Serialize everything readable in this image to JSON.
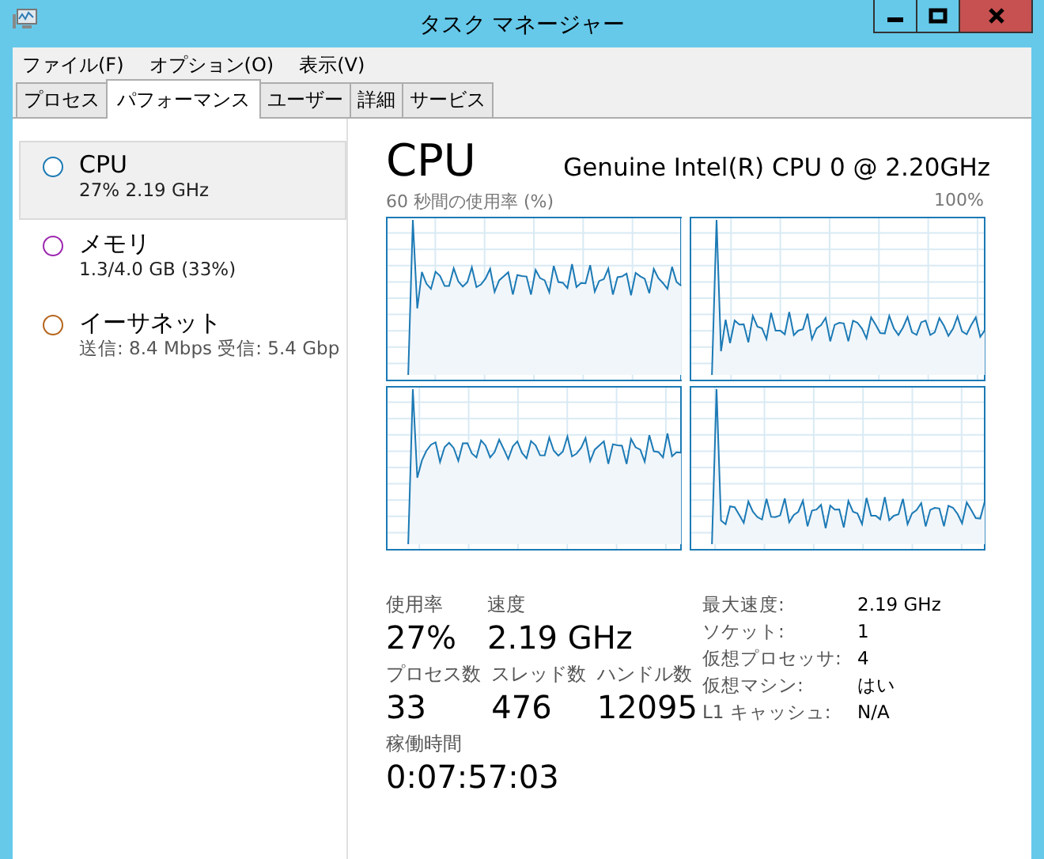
{
  "window": {
    "title": "タスク マネージャー"
  },
  "menu": [
    "ファイル(F)",
    "オプション(O)",
    "表示(V)"
  ],
  "tabs": [
    {
      "label": "プロセス",
      "selected": false
    },
    {
      "label": "パフォーマンス",
      "selected": true
    },
    {
      "label": "ユーザー",
      "selected": false
    },
    {
      "label": "詳細",
      "selected": false
    },
    {
      "label": "サービス",
      "selected": false
    }
  ],
  "sidebar": {
    "items": [
      {
        "name": "CPU",
        "detail": "27% 2.19 GHz",
        "color": "#1c7ab5",
        "selected": true
      },
      {
        "name": "メモリ",
        "detail": "1.3/4.0 GB (33%)",
        "color": "#9c27b0",
        "selected": false
      },
      {
        "name": "イーサネット",
        "detail": "送信: 8.4 Mbps 受信: 5.4 Gbp",
        "color": "#b5651d",
        "selected": false
      }
    ]
  },
  "panel": {
    "title": "CPU",
    "model": "Genuine Intel(R) CPU 0 @ 2.20GHz",
    "graph_label": "60 秒間の使用率 (%)",
    "graph_max": "100%",
    "stats": [
      {
        "label": "使用率",
        "value": "27%"
      },
      {
        "label": "速度",
        "value": "2.19 GHz"
      }
    ],
    "counts": [
      {
        "label": "プロセス数",
        "value": "33"
      },
      {
        "label": "スレッド数",
        "value": "476"
      },
      {
        "label": "ハンドル数",
        "value": "12095"
      }
    ],
    "uptime": {
      "label": "稼働時間",
      "value": "0:07:57:03"
    },
    "details": [
      {
        "key": "最大速度:",
        "value": "2.19 GHz"
      },
      {
        "key": "ソケット:",
        "value": "1"
      },
      {
        "key": "仮想プロセッサ:",
        "value": "4"
      },
      {
        "key": "仮想マシン:",
        "value": "はい"
      },
      {
        "key": "L1 キャッシュ:",
        "value": "N/A"
      }
    ]
  }
}
